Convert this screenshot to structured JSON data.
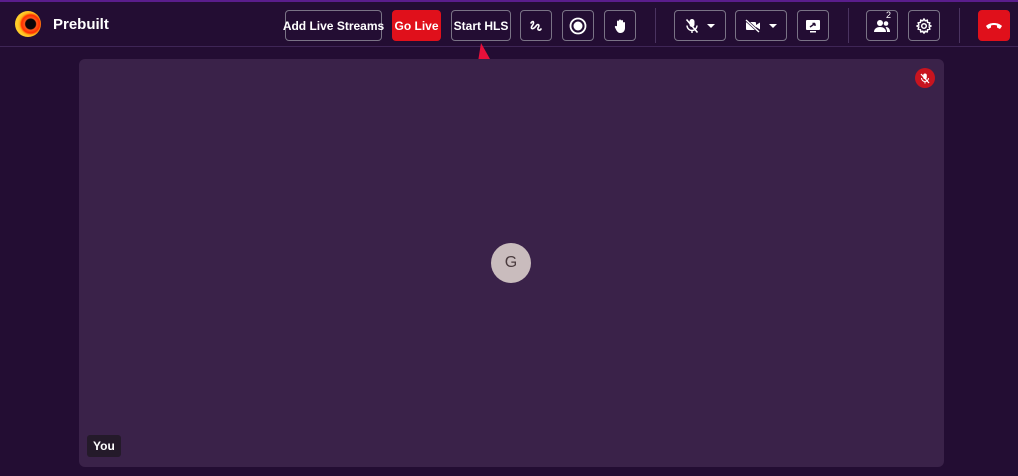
{
  "app": {
    "brand": "Prebuilt"
  },
  "toolbar": {
    "add_live_streams_label": "Add Live Streams",
    "go_live_label": "Go Live",
    "start_hls_label": "Start HLS",
    "participants_count": "2"
  },
  "stage": {
    "avatar_initial": "G",
    "participant_name": "You"
  },
  "colors": {
    "background": "#230d33",
    "stage": "#3a2249",
    "accent_red": "#e0101b",
    "annotation_arrow": "#e8103a"
  },
  "icons": [
    "logo-icon",
    "whiteboard-icon",
    "record-icon",
    "raise-hand-icon",
    "mic-off-icon",
    "chevron-down-icon",
    "camera-off-icon",
    "screen-share-icon",
    "participants-icon",
    "gear-icon",
    "end-call-icon",
    "muted-indicator-icon",
    "annotation-arrow"
  ]
}
